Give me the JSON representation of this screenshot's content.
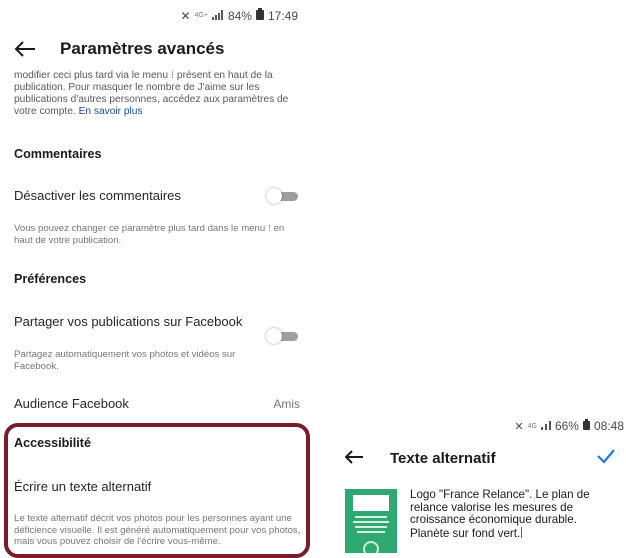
{
  "left_screen": {
    "status_bar": {
      "network": "4G+",
      "battery": "84%",
      "time": "17:49"
    },
    "header": {
      "title": "Paramètres avancés"
    },
    "intro": {
      "text": "modifier ceci plus tard via le menu ⁝ présent en haut de la publication. Pour masquer le nombre de J'aime sur les publications d'autres personnes, accédez aux paramètres de votre compte. ",
      "link": "En savoir plus"
    },
    "comments": {
      "heading": "Commentaires",
      "toggle_label": "Désactiver les commentaires",
      "toggle_on": false,
      "help": "Vous pouvez changer ce paramètre plus tard dans le menu ⁝ en haut de votre publication."
    },
    "preferences": {
      "heading": "Préférences",
      "toggle_label": "Partager vos publications sur Facebook",
      "toggle_on": false,
      "help": "Partagez automatiquement vos photos et vidéos sur Facebook.",
      "audience_label": "Audience Facebook",
      "audience_value": "Amis"
    },
    "accessibility": {
      "heading": "Accessibilité",
      "item_label": "Écrire un texte alternatif",
      "help": "Le texte alternatif décrit vos photos pour les personnes ayant une déficience visuelle. Il est généré automatiquement pour vos photos, mais vous pouvez choisir de l'écrire vous-même.",
      "highlight_color": "#7a1c2c"
    }
  },
  "right_screen": {
    "status_bar": {
      "network": "4G",
      "battery": "66%",
      "time": "08:48"
    },
    "header": {
      "title": "Texte alternatif"
    },
    "alt_text_value": "Logo \"France Relance\". Le plan de relance valorise les mesures de croissance économique durable. Planète sur fond vert.",
    "accent_color": "#1f7ae0"
  }
}
